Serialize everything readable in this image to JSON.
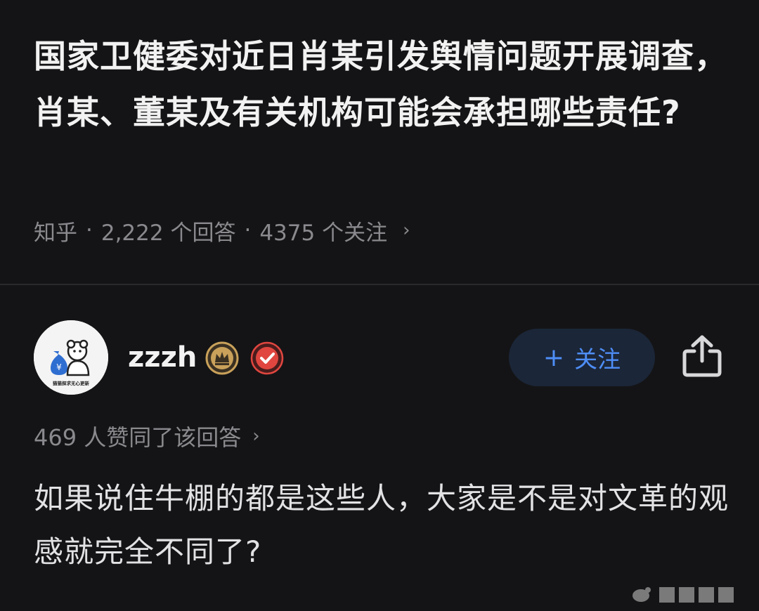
{
  "question": {
    "title": "国家卫健委对近日肖某引发舆情问题开展调查，肖某、董某及有关机构可能会承担哪些责任?",
    "source": "知乎",
    "separator": "·",
    "answers_count": "2,222 个回答",
    "followers_count": "4375 个关注",
    "chevron": "›"
  },
  "answer": {
    "author": {
      "name": "zzzh",
      "avatar_caption": "猫猫探求无心更新",
      "badges": [
        "crown-badge-icon",
        "verified-badge-icon"
      ]
    },
    "follow_button": {
      "plus": "+",
      "label": "关注"
    },
    "share_icon": "share-icon",
    "votes_text": "469 人赞同了该回答",
    "chevron": "›",
    "content": "如果说住牛棚的都是这些人，大家是不是对文革的观感就完全不同了?"
  },
  "colors": {
    "background": "#141416",
    "title_text": "#f2f2f2",
    "meta_text": "#8a8a8e",
    "accent_blue": "#4e8ef7",
    "follow_button_bg": "#1b2638",
    "crown_badge": "#c9a15a",
    "verified_badge": "#e0463f"
  }
}
